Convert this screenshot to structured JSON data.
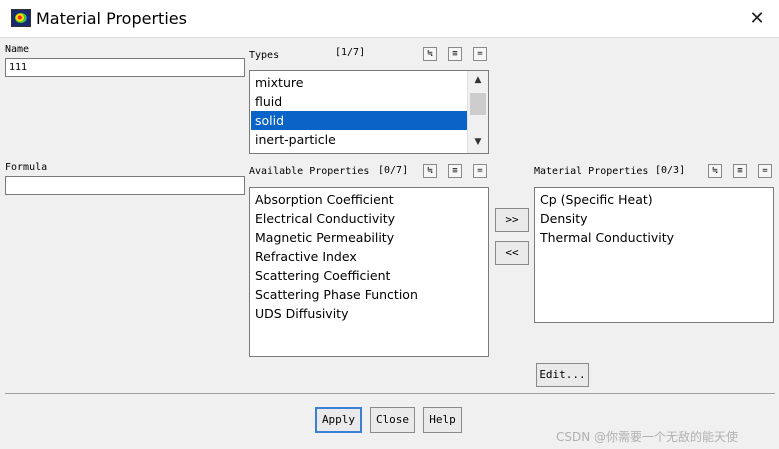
{
  "window": {
    "title": "Material Properties",
    "close_glyph": "✕",
    "icon": "fluent-app-icon"
  },
  "name": {
    "label": "Name",
    "value": "111"
  },
  "formula": {
    "label": "Formula",
    "value": ""
  },
  "types": {
    "label": "Types",
    "count": "[1/7]",
    "items": [
      "mixture",
      "fluid",
      "solid",
      "inert-particle"
    ],
    "selected": "solid"
  },
  "available": {
    "label": "Available Properties",
    "count": "[0/7]",
    "items": [
      "Absorption Coefficient",
      "Electrical Conductivity",
      "Magnetic Permeability",
      "Refractive Index",
      "Scattering Coefficient",
      "Scattering Phase Function",
      "UDS Diffusivity"
    ]
  },
  "material": {
    "label": "Material Properties",
    "count": "[0/3]",
    "items": [
      "Cp (Specific Heat)",
      "Density",
      "Thermal Conductivity"
    ]
  },
  "list_tools": {
    "select_all": "≒",
    "invert": "≡",
    "deselect": "="
  },
  "transfer": {
    "add": ">>",
    "remove": "<<"
  },
  "buttons": {
    "edit": "Edit...",
    "apply": "Apply",
    "close": "Close",
    "help": "Help"
  },
  "watermark": "CSDN @你需要一个无敌的能天使",
  "colors": {
    "selection": "#0a64c8",
    "default_button_border": "#3c7fd6"
  }
}
